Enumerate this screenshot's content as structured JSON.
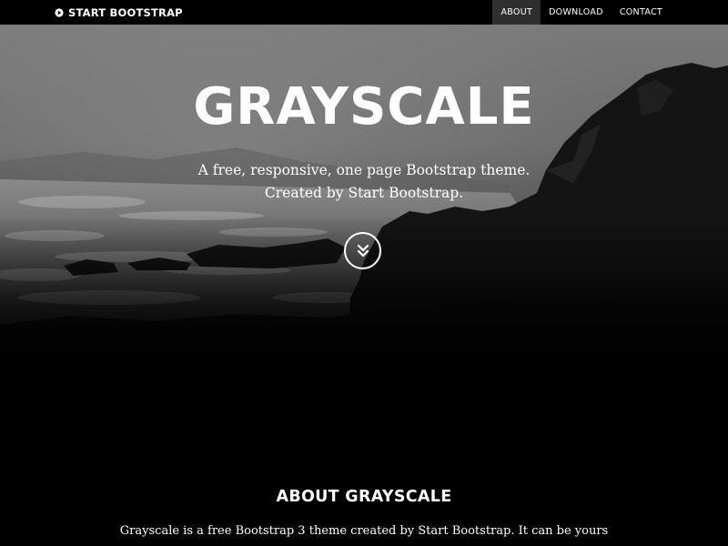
{
  "navbar": {
    "brand": "START BOOTSTRAP",
    "brand_icon": "play-circle-icon",
    "links": [
      {
        "label": "ABOUT",
        "active": true
      },
      {
        "label": "DOWNLOAD",
        "active": false
      },
      {
        "label": "CONTACT",
        "active": false
      }
    ]
  },
  "hero": {
    "title": "GRAYSCALE",
    "subtitle_line1": "A free, responsive, one page Bootstrap theme.",
    "subtitle_line2": "Created by Start Bootstrap.",
    "scroll_icon": "double-chevron-down-icon"
  },
  "about": {
    "title": "ABOUT GRAYSCALE",
    "text": "Grayscale is a free Bootstrap 3 theme created by Start Bootstrap. It can be yours"
  },
  "colors": {
    "background": "#000000",
    "text": "#ffffff",
    "nav_active": "#2f2f2f"
  }
}
